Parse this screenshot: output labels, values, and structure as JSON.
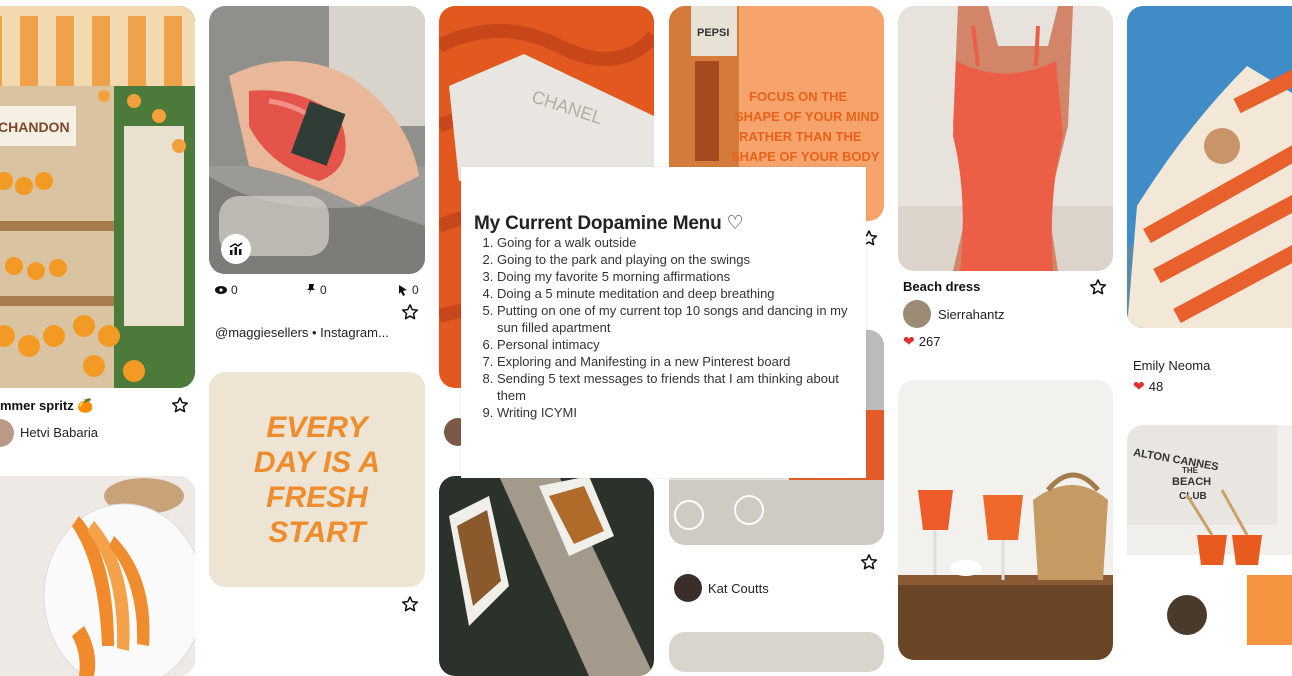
{
  "colors": {
    "accent_orange": "#ef8c2d",
    "heart_red": "#e0302e",
    "cream": "#ede4d3"
  },
  "pins": {
    "summer_spritz": {
      "title": "mmer spritz 🍊",
      "author": "Hetvi Babaria",
      "sign_text": "CHANDON"
    },
    "sofa_phone": {
      "views": "0",
      "saves": "0",
      "clicks": "0",
      "source": "@maggiesellers • Instagram..."
    },
    "quote_card": {
      "lines": [
        "EVERY",
        "DAY IS A",
        "FRESH",
        "START"
      ]
    },
    "chanel_bag": {
      "brand": "CHANEL"
    },
    "mural": {
      "sign": "PEPSI",
      "lines": [
        "FOCUS ON THE",
        "SHAPE OF YOUR MIND",
        "RATHER THAN THE",
        "SHAPE OF YOUR BODY"
      ]
    },
    "kat": {
      "author": "Kat Coutts"
    },
    "beach_dress": {
      "title": "Beach dress",
      "author": "Sierrahantz",
      "likes": "267"
    },
    "towel": {
      "author": "Emily Neoma",
      "likes": "48"
    },
    "beach_club": {
      "sign_lines": [
        "ALTON CANNES",
        "THE",
        "BEACH",
        "CLUB"
      ]
    }
  },
  "menu_card": {
    "title": "My Current Dopamine Menu ♡",
    "items": [
      "Going for a walk outside",
      "Going to the park and playing on the swings",
      "Doing my favorite 5 morning affirmations",
      "Doing a 5 minute meditation and deep breathing",
      "Putting on one of my current top 10 songs and dancing in my sun filled apartment",
      "Personal intimacy",
      "Exploring and Manifesting in a new Pinterest board",
      "Sending 5 text messages to friends that I am thinking about them",
      "Writing ICYMI"
    ]
  },
  "icons": {
    "save": "star-icon",
    "views": "eye-icon",
    "saves": "pin-icon",
    "clicks": "cursor-icon",
    "stats": "analytics-icon",
    "like": "heart-icon"
  }
}
